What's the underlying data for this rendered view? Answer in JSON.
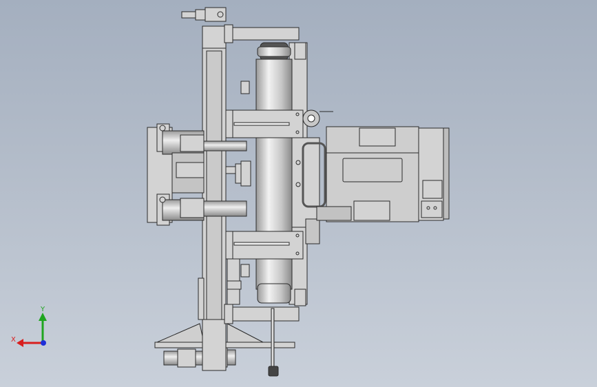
{
  "viewport": {
    "background_top": "#a4afbf",
    "background_bottom": "#c9d0da"
  },
  "model": {
    "part_fill": "#d3d3d3",
    "part_fill_dark": "#bdbdbd",
    "edge_color": "#2a2a2a"
  },
  "triad": {
    "x_label": "X",
    "y_label": "Y",
    "x_color": "#d81e1e",
    "y_color": "#1fa51f",
    "z_color": "#1f2fd8"
  }
}
